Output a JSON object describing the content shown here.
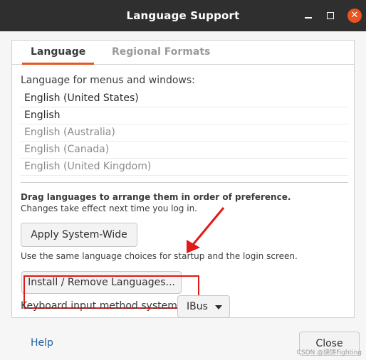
{
  "window": {
    "title": "Language Support"
  },
  "tabs": [
    "Language",
    "Regional Formats"
  ],
  "language_section": {
    "label": "Language for menus and windows:",
    "languages": [
      {
        "label": "English (United States)",
        "state": "active"
      },
      {
        "label": "English",
        "state": "active"
      },
      {
        "label": "English (Australia)",
        "state": "dim"
      },
      {
        "label": "English (Canada)",
        "state": "dim"
      },
      {
        "label": "English (United Kingdom)",
        "state": "dim"
      }
    ],
    "drag_hint": "Drag languages to arrange them in order of preference.",
    "change_hint": "Changes take effect next time you log in.",
    "apply_label": "Apply System-Wide",
    "same_choices_text": "Use the same language choices for startup and the login screen.",
    "install_label": "Install / Remove Languages...",
    "keyboard_label": "Keyboard input method system:",
    "keyboard_value": "IBus"
  },
  "footer": {
    "help_label": "Help",
    "close_label": "Close"
  },
  "watermark": "CSDN @烧饼Fighting",
  "colors": {
    "accent": "#e95420",
    "annotation": "#e11919"
  },
  "icons": {
    "minimize": "minimize-icon",
    "maximize": "maximize-icon",
    "close": "close-icon",
    "dropdown": "chevron-down-icon"
  }
}
